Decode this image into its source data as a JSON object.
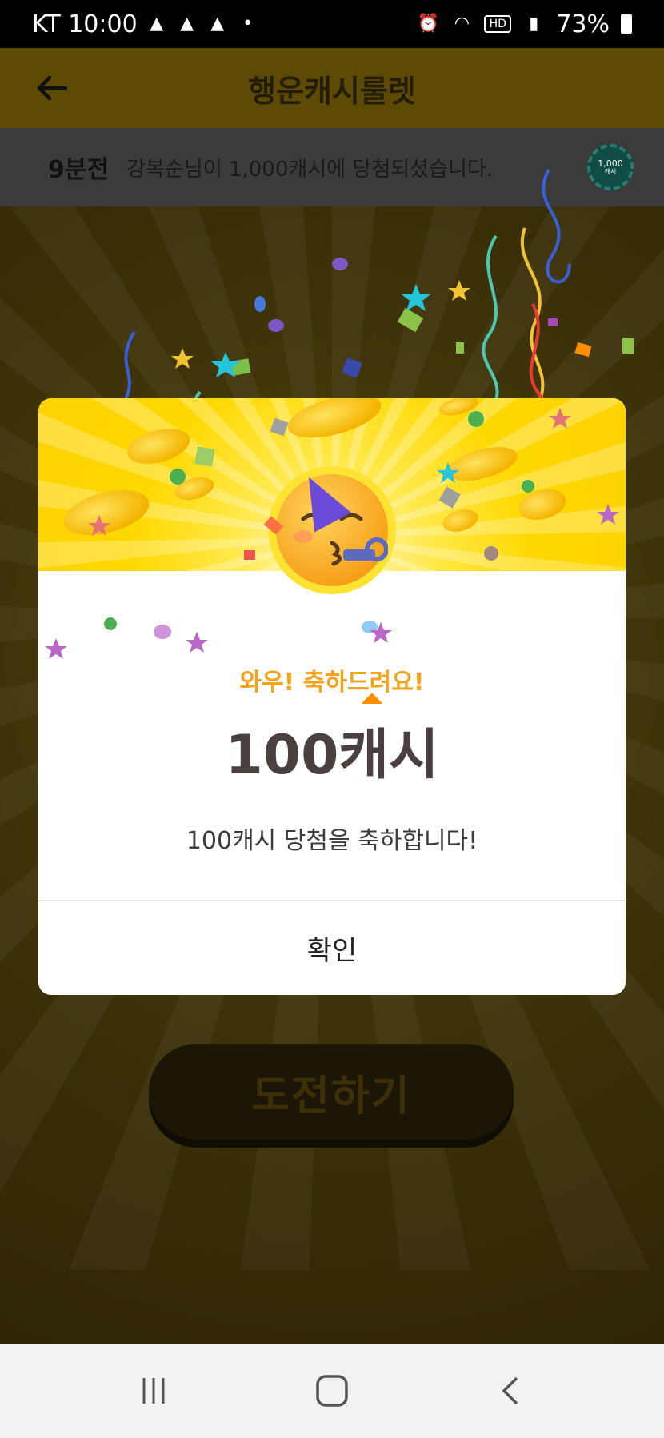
{
  "status_bar": {
    "carrier_time": "KT 10:00",
    "battery": "73%",
    "icons": [
      "notification-icon",
      "notification-icon",
      "notification-icon",
      "dot-icon",
      "alarm-icon",
      "wifi-icon",
      "hd-icon",
      "signal-icon",
      "battery-icon"
    ]
  },
  "header": {
    "title": "행운캐시룰렛",
    "back_icon": "arrow-left-icon"
  },
  "ticker": {
    "time_ago": "9분전",
    "message": "강복순님이 1,000캐시에 당첨되셨습니다.",
    "badge_value": "1,000",
    "badge_unit": "캐시"
  },
  "dialog": {
    "congrats_text": "와우! 축하드려요!",
    "prize_amount": "100캐시",
    "prize_message": "100캐시 당첨을 축하합니다!",
    "confirm_label": "확인"
  },
  "main": {
    "challenge_label": "도전하기"
  },
  "nav_bar": {
    "items": [
      "recent-apps-icon",
      "home-icon",
      "back-icon"
    ]
  },
  "colors": {
    "accent_yellow": "#ffd800",
    "congrats_orange": "#f2a51c",
    "prize_text": "#4a4040"
  }
}
